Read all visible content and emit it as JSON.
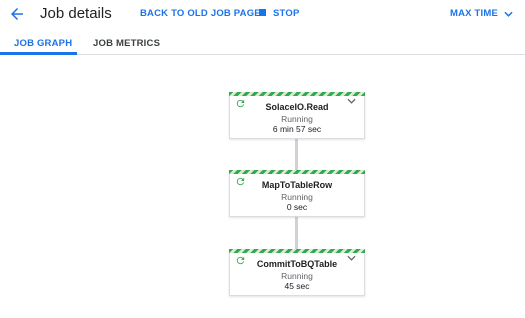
{
  "header": {
    "title": "Job details",
    "back_to_old_label": "BACK TO OLD JOB PAGE",
    "stop_label": "STOP",
    "max_time_label": "MAX TIME"
  },
  "tabs": [
    {
      "label": "JOB GRAPH",
      "active": true
    },
    {
      "label": "JOB METRICS",
      "active": false
    }
  ],
  "nodes": [
    {
      "name": "SolaceIO.Read",
      "status": "Running",
      "time": "6 min 57 sec"
    },
    {
      "name": "MapToTableRow",
      "status": "Running",
      "time": "0 sec"
    },
    {
      "name": "CommitToBQTable",
      "status": "Running",
      "time": "45 sec"
    }
  ],
  "colors": {
    "accent": "#1a73e8",
    "running": "#34a853"
  },
  "icons": {
    "back": "arrow-back-icon",
    "stop": "stop-icon",
    "max_time": "chevron-down-icon",
    "node_status": "running-refresh-icon",
    "node_expand": "chevron-down-icon"
  }
}
